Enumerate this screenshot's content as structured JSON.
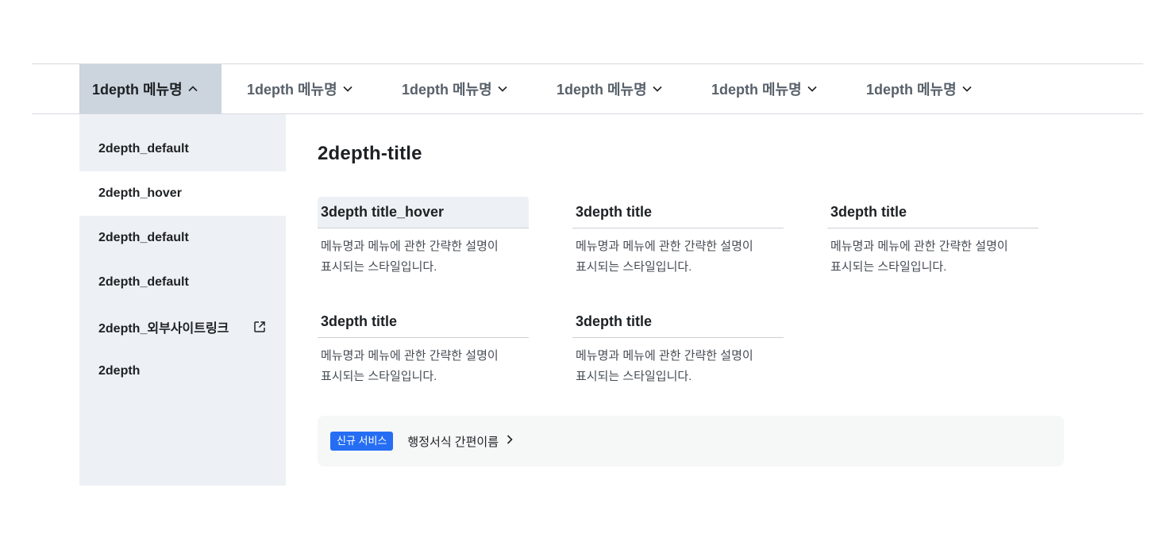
{
  "nav": {
    "items": [
      {
        "label": "1depth 메뉴명",
        "expanded": true
      },
      {
        "label": "1depth 메뉴명",
        "expanded": false
      },
      {
        "label": "1depth 메뉴명",
        "expanded": false
      },
      {
        "label": "1depth 메뉴명",
        "expanded": false
      },
      {
        "label": "1depth 메뉴명",
        "expanded": false
      },
      {
        "label": "1depth 메뉴명",
        "expanded": false
      }
    ]
  },
  "submenu": {
    "items": [
      {
        "label": "2depth_default",
        "state": "default"
      },
      {
        "label": "2depth_hover",
        "state": "hover"
      },
      {
        "label": "2depth_default",
        "state": "default"
      },
      {
        "label": "2depth_default",
        "state": "default"
      },
      {
        "label": "2depth_외부사이트링크",
        "state": "default",
        "icon": "external-link-icon"
      },
      {
        "label": "2depth",
        "state": "default"
      }
    ]
  },
  "panel": {
    "title": "2depth-title",
    "cards": [
      {
        "title": "3depth title_hover",
        "desc1": "메뉴명과 메뉴에 관한 간략한 설명이",
        "desc2": "표시되는 스타일입니다."
      },
      {
        "title": "3depth title",
        "desc1": "메뉴명과 메뉴에 관한 간략한 설명이",
        "desc2": "표시되는 스타일입니다."
      },
      {
        "title": "3depth title",
        "desc1": "메뉴명과 메뉴에 관한 간략한 설명이",
        "desc2": "표시되는 스타일입니다."
      },
      {
        "title": "3depth title",
        "desc1": "메뉴명과 메뉴에 관한 간략한 설명이",
        "desc2": "표시되는 스타일입니다."
      },
      {
        "title": "3depth title",
        "desc1": "메뉴명과 메뉴에 관한 간략한 설명이",
        "desc2": "표시되는 스타일입니다."
      }
    ]
  },
  "banner": {
    "badge": "신규 서비스",
    "link": "행정서식 간편이름",
    "link_icon": "chevron-right-icon"
  },
  "colors": {
    "accent": "#256ef4",
    "active_nav_bg": "#ccd4de",
    "submenu_bg": "#edf0f4",
    "banner_bg": "#f6f7f7",
    "text": "#1e2124"
  }
}
